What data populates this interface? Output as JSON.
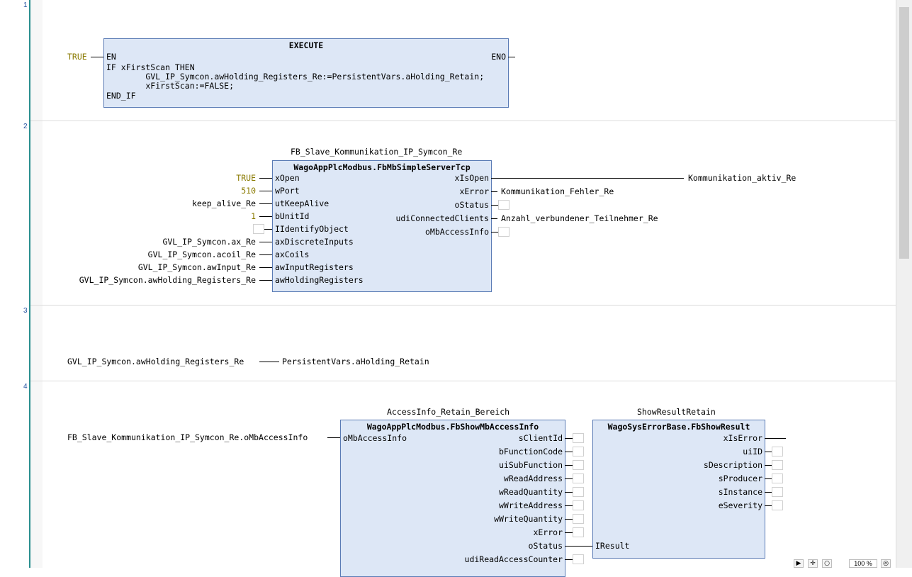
{
  "networks": [
    {
      "number": "1",
      "title": "EXECUTE",
      "en": "EN",
      "eno": "ENO",
      "en_input": "TRUE",
      "code": [
        "IF xFirstScan THEN",
        "        GVL_IP_Symcon.awHolding_Registers_Re:=PersistentVars.aHolding_Retain;",
        "        xFirstScan:=FALSE;",
        "END_IF"
      ]
    },
    {
      "number": "2",
      "instance": "FB_Slave_Kommunikation_IP_Symcon_Re",
      "type": "WagoAppPlcModbus.FbMbSimpleServerTcp",
      "inputs": [
        {
          "name": "xOpen",
          "value": "TRUE"
        },
        {
          "name": "wPort",
          "value": "510"
        },
        {
          "name": "utKeepAlive",
          "value": "keep_alive_Re"
        },
        {
          "name": "bUnitId",
          "value": "1"
        },
        {
          "name": "IIdentifyObject",
          "value": ""
        },
        {
          "name": "axDiscreteInputs",
          "value": "GVL_IP_Symcon.ax_Re"
        },
        {
          "name": "axCoils",
          "value": "GVL_IP_Symcon.acoil_Re"
        },
        {
          "name": "awInputRegisters",
          "value": "GVL_IP_Symcon.awInput_Re"
        },
        {
          "name": "awHoldingRegisters",
          "value": "GVL_IP_Symcon.awHolding_Registers_Re"
        }
      ],
      "outputs": [
        {
          "name": "xIsOpen",
          "value": "Kommunikation_aktiv_Re"
        },
        {
          "name": "xError",
          "value": "Kommunikation_Fehler_Re"
        },
        {
          "name": "oStatus",
          "value": ""
        },
        {
          "name": "udiConnectedClients",
          "value": "Anzahl_verbundener_Teilnehmer_Re"
        },
        {
          "name": "oMbAccessInfo",
          "value": ""
        }
      ]
    },
    {
      "number": "3",
      "source": "GVL_IP_Symcon.awHolding_Registers_Re",
      "target": "PersistentVars.aHolding_Retain"
    },
    {
      "number": "4",
      "fb1": {
        "instance": "AccessInfo_Retain_Bereich",
        "type": "WagoAppPlcModbus.FbShowMbAccessInfo",
        "input_name": "oMbAccessInfo",
        "input_value": "FB_Slave_Kommunikation_IP_Symcon_Re.oMbAccessInfo",
        "outputs": [
          "sClientId",
          "bFunctionCode",
          "uiSubFunction",
          "wReadAddress",
          "wReadQuantity",
          "wWriteAddress",
          "wWriteQuantity",
          "xError",
          "oStatus",
          "udiReadAccessCounter"
        ]
      },
      "fb2": {
        "instance": "ShowResultRetain",
        "type": "WagoSysErrorBase.FbShowResult",
        "input_name": "IResult",
        "outputs": [
          "xIsError",
          "uiID",
          "sDescription",
          "sProducer",
          "sInstance",
          "eSeverity"
        ]
      }
    }
  ],
  "toolbar": {
    "zoom": "100 %",
    "pointer_icon": "pointer-icon",
    "move_icon": "move-icon",
    "zoom_icon": "magnifier-icon"
  }
}
